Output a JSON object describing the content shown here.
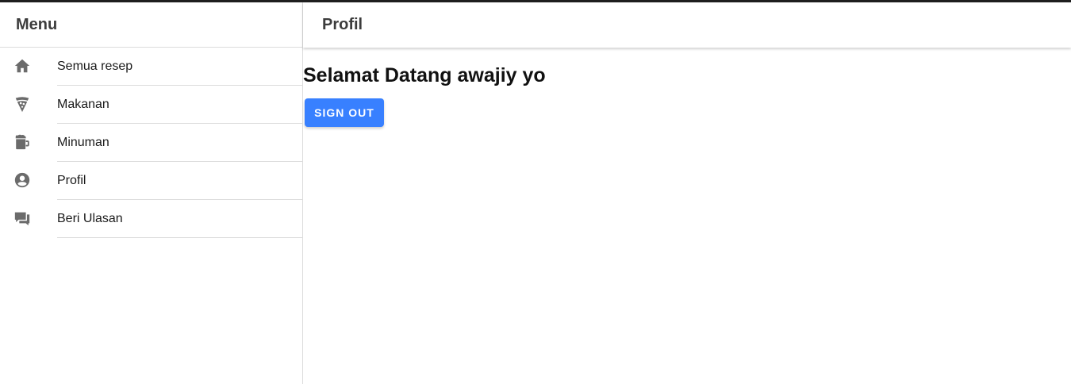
{
  "sidebar": {
    "title": "Menu",
    "items": [
      {
        "label": "Semua resep",
        "icon": "home-icon"
      },
      {
        "label": "Makanan",
        "icon": "pizza-icon"
      },
      {
        "label": "Minuman",
        "icon": "beer-mug-icon"
      },
      {
        "label": "Profil",
        "icon": "person-circle-icon"
      },
      {
        "label": "Beri Ulasan",
        "icon": "chatboxes-icon"
      }
    ]
  },
  "main": {
    "title": "Profil",
    "welcome_text": "Selamat Datang awajiy yo",
    "signout_label": "SIGN OUT"
  },
  "colors": {
    "primary": "#3880ff",
    "icon": "#6b6b6b",
    "divider": "#dcdcdc"
  }
}
